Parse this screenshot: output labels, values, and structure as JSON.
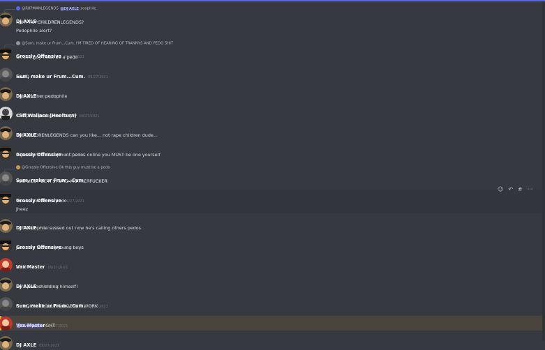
{
  "messages": [
    {
      "reply": {
        "author": "@R8PMANLEGENDS",
        "mention": "@DJ AXLE",
        "text": "zoophile"
      },
      "author": "DJ AXLE",
      "timestamp": "09/27/2021",
      "lines": [
        "Huh? R8PCHILDRENLEGENDS?",
        "Pedophile alert?"
      ]
    },
    {
      "reply": {
        "author": "@Sum, make ur Frum...Cum.",
        "text": "I'M TIRED OF HEARING OF TRANNYS AND PEDO SHIT"
      },
      "author": "Grossly Offensive",
      "timestamp": "09/27/2021",
      "lines": [
        "Ok this guy must be a pedo"
      ]
    },
    {
      "author": "Sum, make ur Frum...Cum.",
      "timestamp": "09/27/2021",
      "lines": [
        "LAWD"
      ]
    },
    {
      "author": "DJ AXLE",
      "timestamp": "09/27/2021",
      "lines": [
        "Ugh another pedophile"
      ]
    },
    {
      "author": "Cliff Wallace (Heelturn)",
      "timestamp": "09/27/2021",
      "lines": [
        "*zoophile pedophile furry**"
      ]
    },
    {
      "author": "DJ AXLE",
      "timestamp": "09/27/2021",
      "lines": [
        "R8PCHILDRENLEGENDS can you like... not rape children dude..."
      ]
    },
    {
      "author": "Grossly Offensive",
      "timestamp": "09/27/2021",
      "lines": [
        "If you dont actively hunt pedos online you MUST be one yourself"
      ]
    },
    {
      "reply": {
        "author": "@Grossly Offensive",
        "text": "Ok this guy must be a pedo"
      },
      "author": "Sum, make ur Frum...Cum.",
      "timestamp": "09/27/2021",
      "lines": [
        "YOU MUST BE A STUPID MOTHERFUCKER"
      ]
    },
    {
      "author": "Grossly Offensive",
      "timestamp": "09/27/2021",
      "lines": [
        "Woah calm down pedo",
        "Jheez"
      ]
    },
    {
      "author": "DJ AXLE",
      "timestamp": "09/27/2021",
      "lines": [
        "Cliff Pedophile sussed out now he's calling others pedos"
      ]
    },
    {
      "author": "Grossly Offensive",
      "timestamp": "09/27/2021",
      "lines": [
        "Just stop touching young boys"
      ]
    },
    {
      "author": "Vax Master",
      "timestamp": "09/27/2021",
      "lines": [
        "HUM"
      ]
    },
    {
      "author": "DJ AXLE",
      "timestamp": "09/27/2021",
      "lines": [
        "He's pedoshielding himself!"
      ]
    },
    {
      "author": "Sum, make ur Frum...Cum.",
      "timestamp": "09/27/2021",
      "lines": [
        "CHILDISH TROLLING DOESN'T WORK"
      ]
    },
    {
      "author": "Vax Master",
      "timestamp": "09/27/2021",
      "mention": "@everyone",
      "lines": [
        "IGHT"
      ]
    },
    {
      "author": "DJ AXLE",
      "timestamp": "09/27/2021",
      "lines": []
    }
  ],
  "toolbar": {
    "react_icon": "emoji-icon",
    "reply_icon": "reply-icon",
    "thread_icon": "thread-icon",
    "more_icon": "more-icon",
    "react": "☺",
    "reply": "↶",
    "thread": "#",
    "more": "···"
  },
  "colors": {
    "background": "#36393f",
    "accent": "#5865f2",
    "mention_highlight": "#49443c",
    "mention_bar": "#faa81a"
  }
}
